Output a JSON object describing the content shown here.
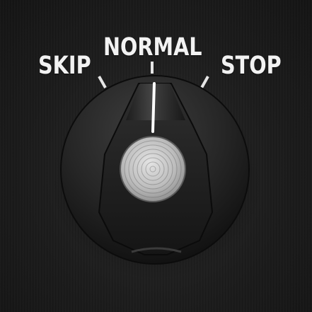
{
  "control": {
    "type": "rotary-selector-knob",
    "selected_position": "NORMAL",
    "positions": [
      {
        "label": "SKIP"
      },
      {
        "label": "NORMAL"
      },
      {
        "label": "STOP"
      }
    ]
  },
  "colors": {
    "background": "#1f1f1f",
    "label_text": "#f2f2f2",
    "knob_body": "#2b2b2b",
    "pointer_line": "#ffffff",
    "cap_metal": "#c8c8c8"
  },
  "icons": {
    "knob": "rotary-knob-icon",
    "cap": "brushed-metal-cap-icon"
  }
}
